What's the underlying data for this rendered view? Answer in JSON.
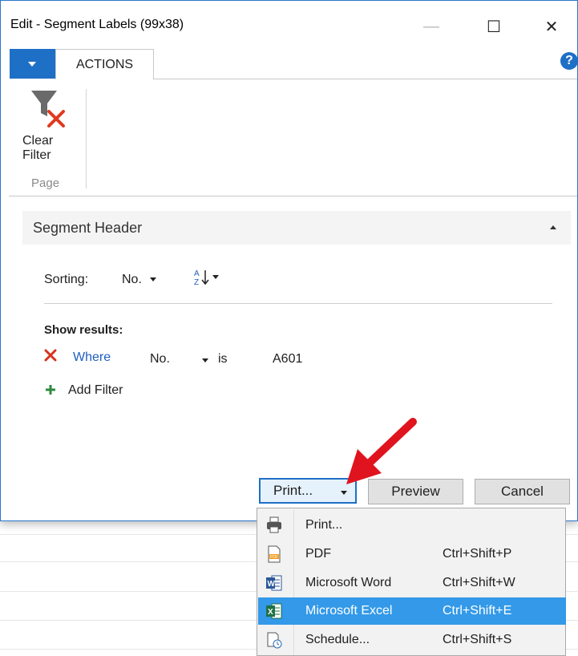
{
  "window": {
    "title": "Edit - Segment Labels (99x38)",
    "minimize_glyph": "—",
    "maximize_glyph": "☐",
    "close_glyph": "✕"
  },
  "ribbon": {
    "tab_actions": "ACTIONS",
    "help_glyph": "?",
    "clear_filter_line1": "Clear",
    "clear_filter_line2": "Filter",
    "group_page": "Page"
  },
  "segment": {
    "header": "Segment Header",
    "sorting_label": "Sorting:",
    "sorting_value": "No.",
    "show_results": "Show results:",
    "filter_where": "Where",
    "filter_field": "No.",
    "filter_op": "is",
    "filter_value": "A601",
    "add_filter": "Add Filter"
  },
  "buttons": {
    "print": "Print...",
    "preview": "Preview",
    "cancel": "Cancel"
  },
  "dropdown": {
    "items": [
      {
        "label": "Print...",
        "shortcut": "",
        "icon": "printer-icon"
      },
      {
        "label": "PDF",
        "shortcut": "Ctrl+Shift+P",
        "icon": "pdf-icon"
      },
      {
        "label": "Microsoft Word",
        "shortcut": "Ctrl+Shift+W",
        "icon": "word-icon"
      },
      {
        "label": "Microsoft Excel",
        "shortcut": "Ctrl+Shift+E",
        "icon": "excel-icon"
      },
      {
        "label": "Schedule...",
        "shortcut": "Ctrl+Shift+S",
        "icon": "schedule-icon"
      }
    ],
    "selected": "Microsoft Excel"
  },
  "colors": {
    "accent": "#1e6fc6",
    "selection": "#3399e8",
    "arrow": "#e0141e",
    "remove": "#d6321e",
    "add": "#2e8b3e"
  }
}
